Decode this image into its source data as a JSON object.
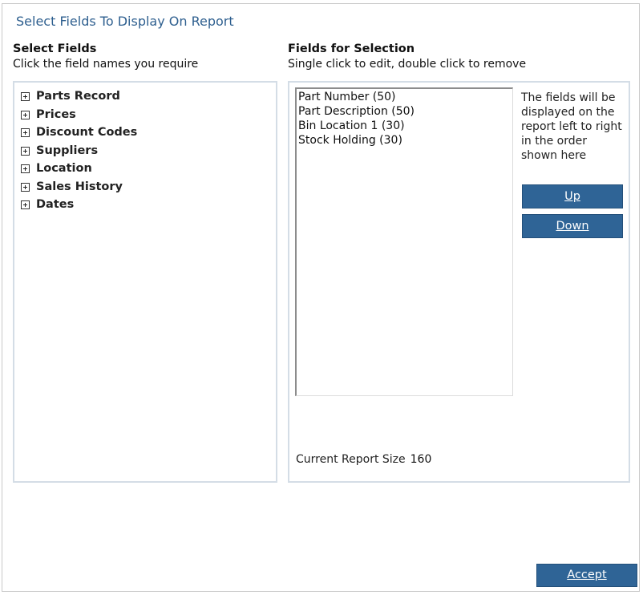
{
  "dialog": {
    "title": "Select Fields To Display On Report"
  },
  "left_section": {
    "heading": "Select Fields",
    "subheading": "Click the field names you require",
    "tree_items": [
      {
        "label": "Parts Record"
      },
      {
        "label": "Prices"
      },
      {
        "label": "Discount Codes"
      },
      {
        "label": "Suppliers"
      },
      {
        "label": "Location"
      },
      {
        "label": "Sales History"
      },
      {
        "label": "Dates"
      }
    ]
  },
  "right_section": {
    "heading": "Fields for Selection",
    "subheading": "Single click to edit, double click to remove",
    "selected_fields": [
      "Part Number (50)",
      "Part Description (50)",
      "Bin Location 1 (30)",
      "Stock Holding (30)"
    ],
    "info_text": "The fields will be displayed on the report left to right in the order shown here",
    "up_label": "Up",
    "down_label": "Down",
    "report_size_label": "Current Report Size",
    "report_size_value": "160"
  },
  "footer": {
    "accept_label": "Accept"
  },
  "colors": {
    "accent": "#2f6496",
    "title": "#2e5f8f",
    "panel_border": "#d4dde6"
  }
}
